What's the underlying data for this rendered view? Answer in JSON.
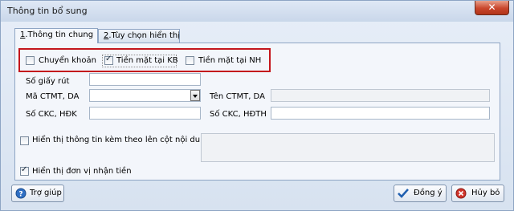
{
  "window": {
    "title": "Thông tin bổ sung"
  },
  "tabs": [
    {
      "hotkey": "1",
      "label": ".Thông tin chung"
    },
    {
      "hotkey": "2",
      "label": ".Tùy chọn hiển thị"
    }
  ],
  "payment_options": [
    {
      "label": "Chuyển khoản",
      "checked": false
    },
    {
      "label": "Tiền mặt tại KB",
      "checked": true
    },
    {
      "label": "Tiền mặt tại NH",
      "checked": false
    }
  ],
  "fields": {
    "so_giay_rut": {
      "label": "Số giấy rút",
      "value": ""
    },
    "ma_ctmt": {
      "label": "Mã CTMT, DA",
      "value": ""
    },
    "ten_ctmt": {
      "label": "Tên CTMT, DA",
      "value": ""
    },
    "so_ckc_hdk": {
      "label": "Số CKC, HĐK",
      "value": ""
    },
    "so_ckc_hdth": {
      "label": "Số CKC, HĐTH",
      "value": ""
    }
  },
  "display_options": {
    "attach_info": {
      "label": "Hiển thị thông tin kèm theo lên cột nội dung",
      "checked": false
    },
    "recipient_unit": {
      "label": "Hiển thị đơn vị nhận tiền",
      "checked": true
    }
  },
  "buttons": {
    "help": "Trợ giúp",
    "ok": "Đồng ý",
    "cancel": "Hủy bỏ"
  },
  "colors": {
    "highlight": "#c4161c",
    "accent": "#1f5fb0"
  }
}
